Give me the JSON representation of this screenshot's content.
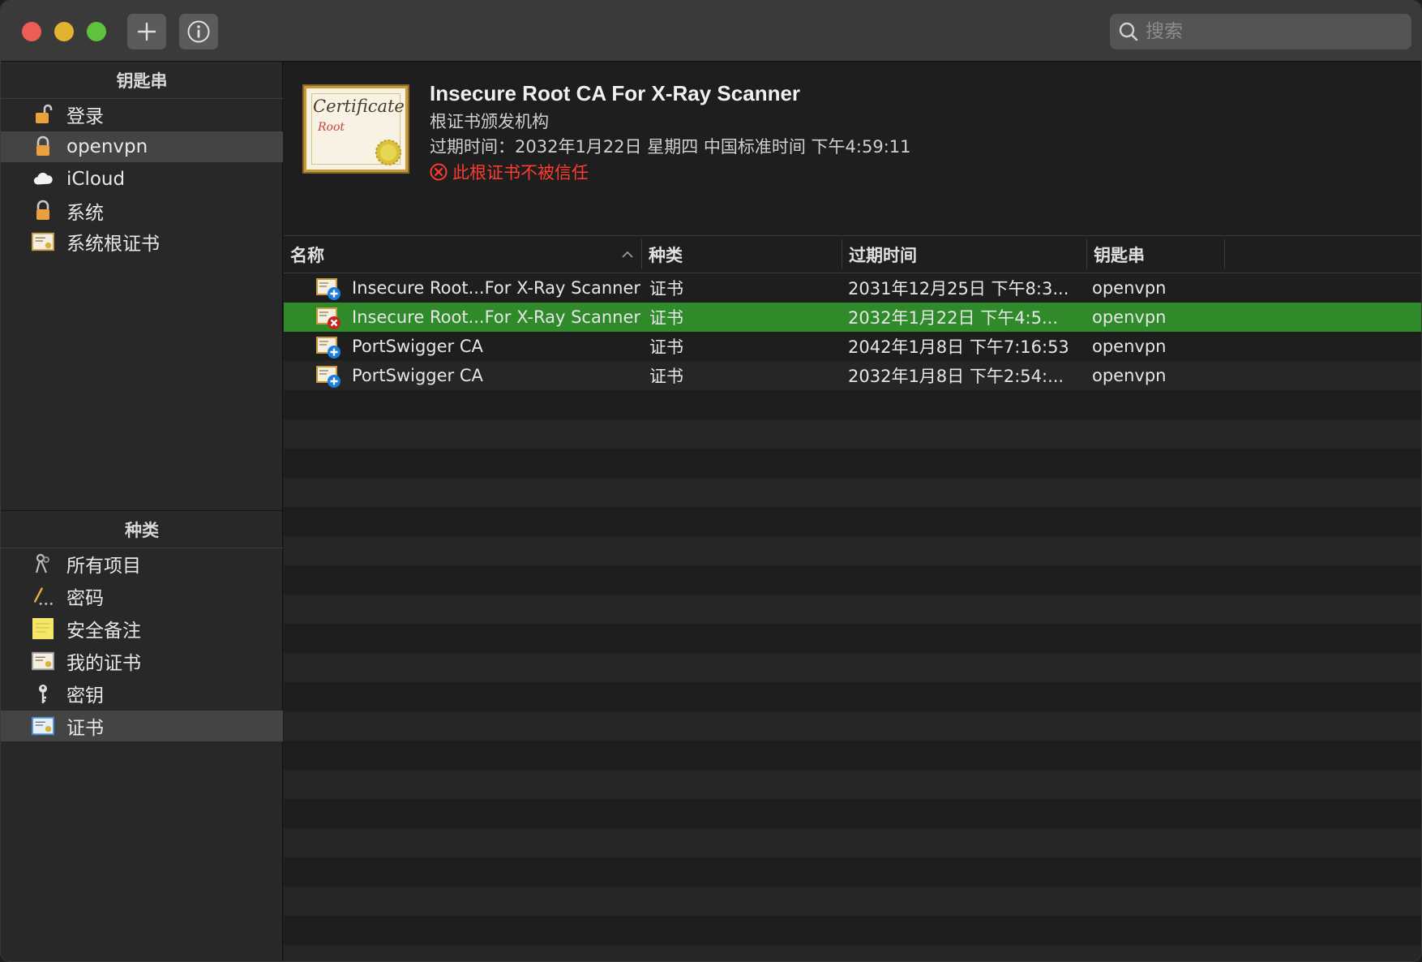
{
  "titlebar": {
    "add_button": "+",
    "info_button": "i",
    "search_placeholder": "搜索"
  },
  "sidebar": {
    "keychains_header": "钥匙串",
    "keychains": [
      {
        "label": "登录",
        "icon": "unlocked-lock-icon"
      },
      {
        "label": "openvpn",
        "icon": "lock-icon",
        "selected": true
      },
      {
        "label": "iCloud",
        "icon": "cloud-icon"
      },
      {
        "label": "系统",
        "icon": "lock-icon"
      },
      {
        "label": "系统根证书",
        "icon": "certificate-icon"
      }
    ],
    "categories_header": "种类",
    "categories": [
      {
        "label": "所有项目",
        "icon": "keys-icon"
      },
      {
        "label": "密码",
        "icon": "password-pen-icon"
      },
      {
        "label": "安全备注",
        "icon": "note-icon"
      },
      {
        "label": "我的证书",
        "icon": "my-certificate-icon"
      },
      {
        "label": "密钥",
        "icon": "key-icon"
      },
      {
        "label": "证书",
        "icon": "certificate-icon",
        "selected": true
      }
    ]
  },
  "detail": {
    "cert_word": "Certificate",
    "cert_root_word": "Root",
    "title": "Insecure Root CA For X-Ray Scanner",
    "subtitle": "根证书颁发机构",
    "expiry": "过期时间：2032年1月22日 星期四 中国标准时间 下午4:59:11",
    "warning": "此根证书不被信任",
    "warning_color": "#ff3b30"
  },
  "table": {
    "columns": [
      "名称",
      "种类",
      "过期时间",
      "钥匙串"
    ],
    "rows": [
      {
        "name": "Insecure Root...For X-Ray Scanner",
        "kind": "证书",
        "expires": "2031年12月25日 下午8:3...",
        "keychain": "openvpn",
        "icon": "certificate-plus-icon"
      },
      {
        "name": "Insecure Root...For X-Ray Scanner",
        "kind": "证书",
        "expires": "2032年1月22日 下午4:5...",
        "keychain": "openvpn",
        "icon": "certificate-untrusted-icon",
        "selected": true
      },
      {
        "name": "PortSwigger CA",
        "kind": "证书",
        "expires": "2042年1月8日 下午7:16:53",
        "keychain": "openvpn",
        "icon": "certificate-plus-icon"
      },
      {
        "name": "PortSwigger CA",
        "kind": "证书",
        "expires": "2032年1月8日 下午2:54:...",
        "keychain": "openvpn",
        "icon": "certificate-plus-icon"
      }
    ],
    "selection_color": "#2f8b29"
  }
}
